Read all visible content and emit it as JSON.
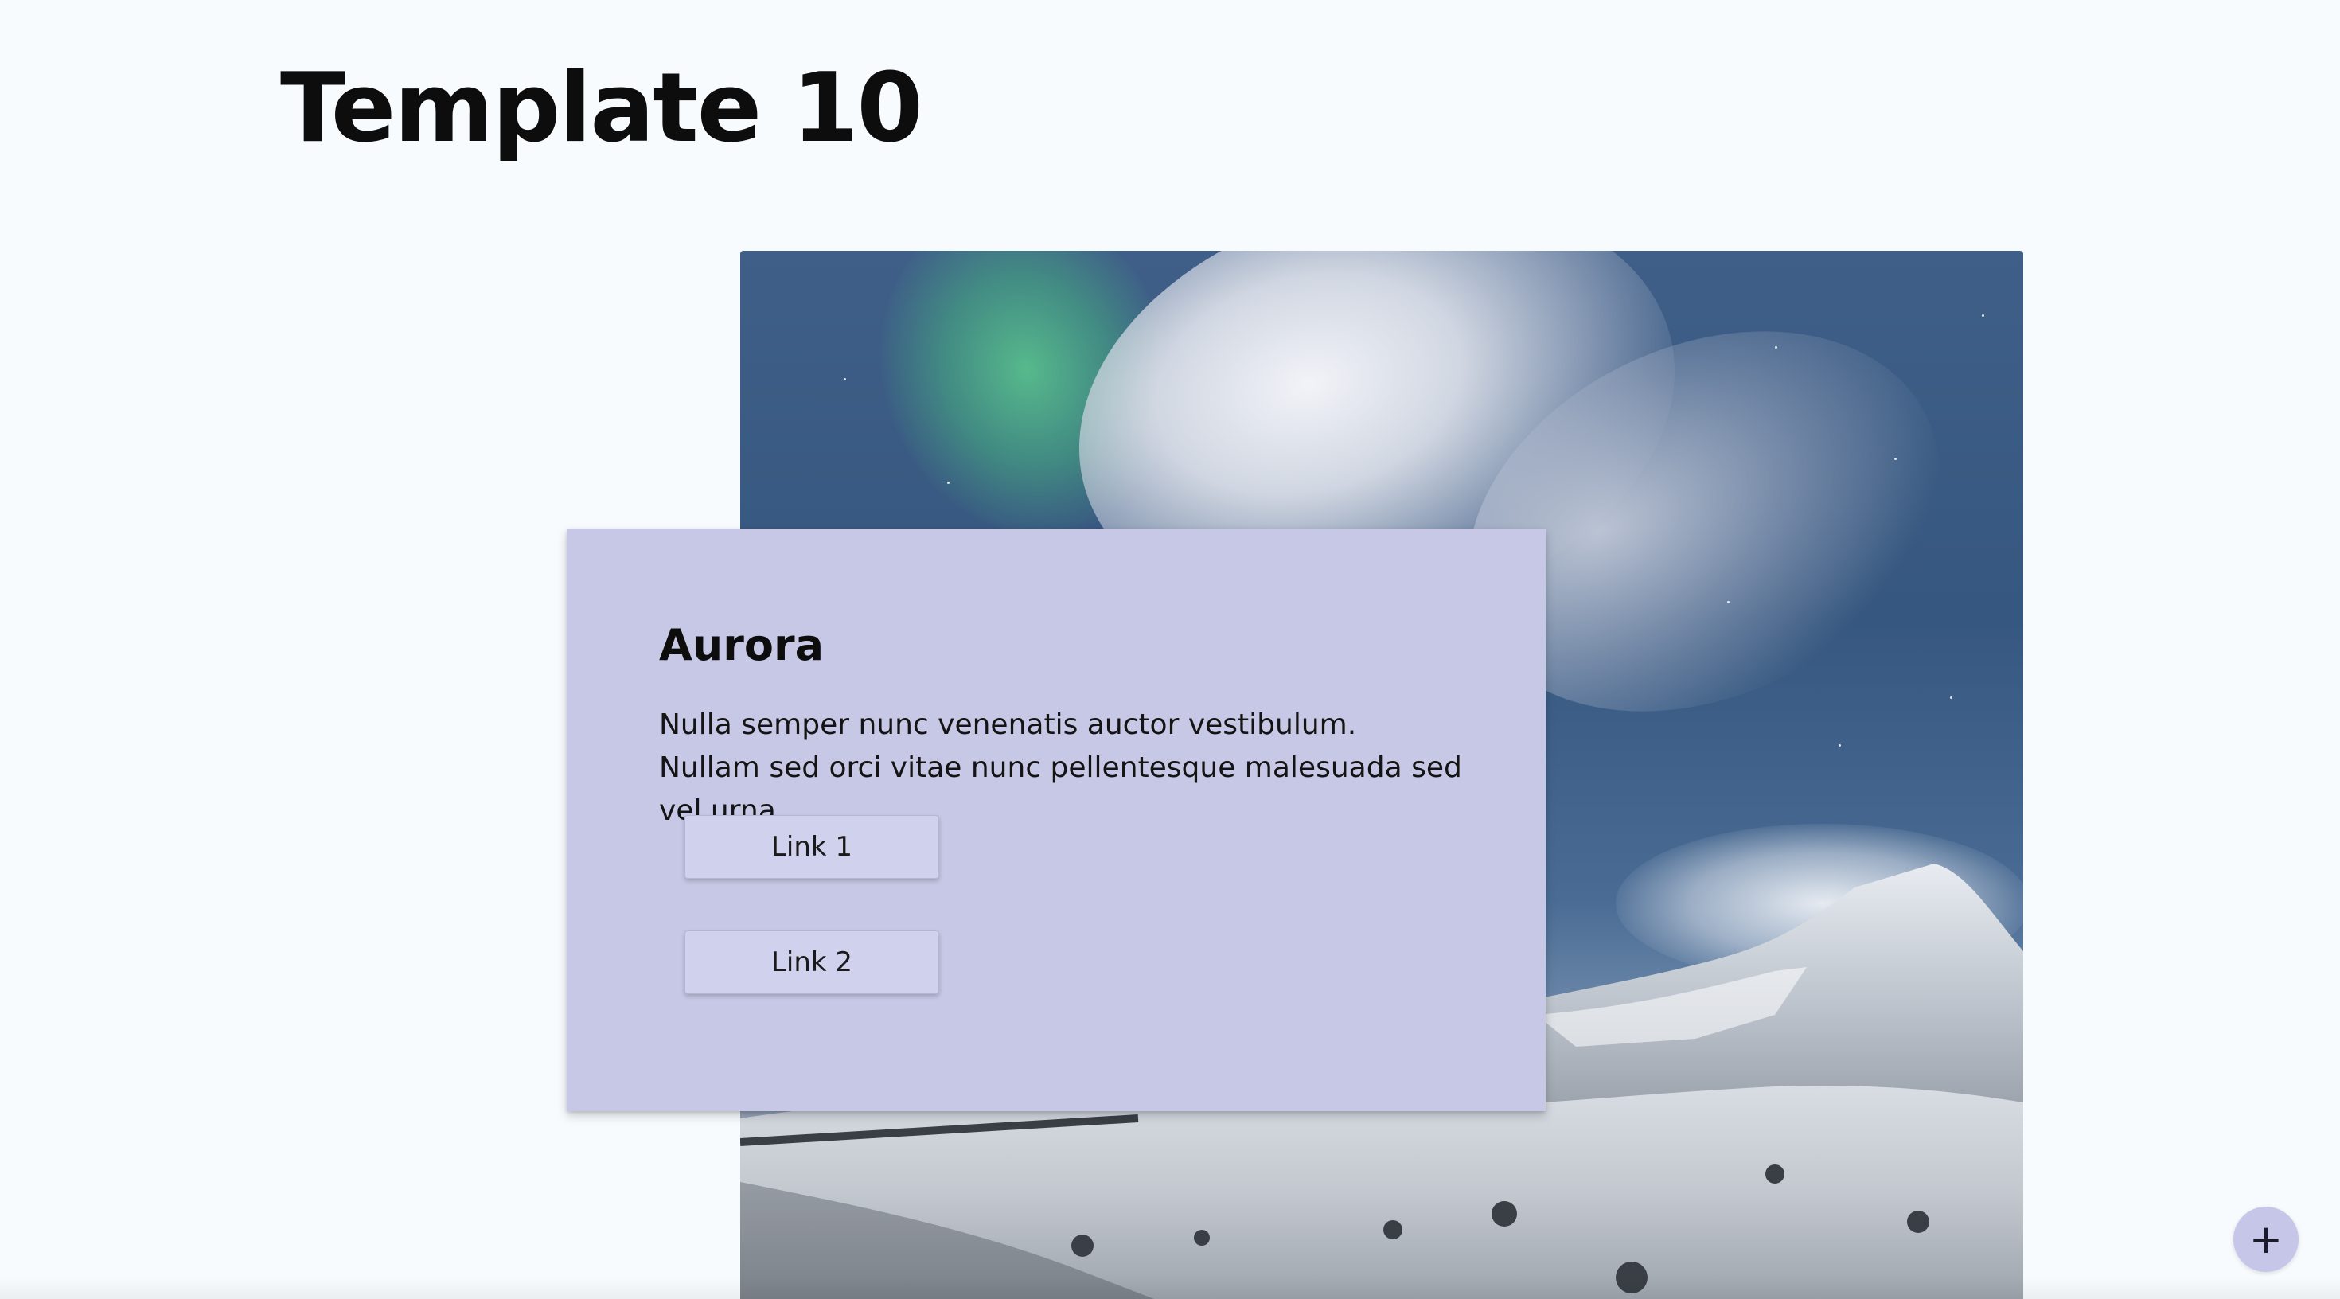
{
  "page": {
    "title": "Template 10"
  },
  "hero_image": {
    "alt": "Aurora over snowy mountains",
    "icon": "landscape-photo"
  },
  "card": {
    "title": "Aurora",
    "body": "Nulla semper nunc venenatis auctor vestibulum. Nullam sed orci vitae nunc pellentesque malesuada sed vel urna.",
    "background": "#c7c8e6",
    "links": [
      {
        "label": "Link 1"
      },
      {
        "label": "Link 2"
      }
    ]
  },
  "fab": {
    "icon": "plus-icon",
    "glyph": "+",
    "color": "#c6c7e8"
  }
}
